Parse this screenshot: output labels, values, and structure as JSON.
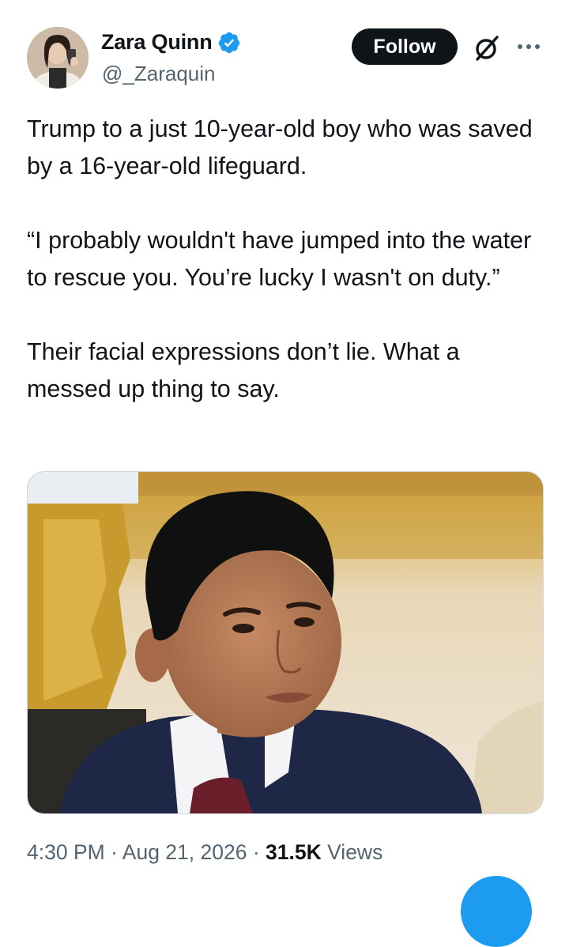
{
  "author": {
    "display_name": "Zara Quinn",
    "handle": "@_Zaraquin",
    "verified": true,
    "avatar_icon": "profile-photo"
  },
  "actions": {
    "follow_label": "Follow",
    "grok_icon": "grok-icon",
    "more_icon": "more-options-icon"
  },
  "tweet": {
    "paragraphs": [
      "Trump to a just 10-year-old boy who was saved by a 16-year-old lifeguard.",
      "“I probably wouldn't have jumped into the water to rescue you. You’re lucky I wasn't on duty.”",
      "Their facial expressions don’t lie. What a messed up thing to say."
    ]
  },
  "media": {
    "kind": "photo"
  },
  "meta": {
    "time": "4:30 PM",
    "date": "Aug 21, 2026",
    "separator": " · ",
    "views_count": "31.5K",
    "views_label": " Views"
  },
  "colors": {
    "text_primary": "#0f1419",
    "text_secondary": "#536471",
    "verified_blue": "#1d9bf0",
    "follow_bg": "#0f1419"
  }
}
